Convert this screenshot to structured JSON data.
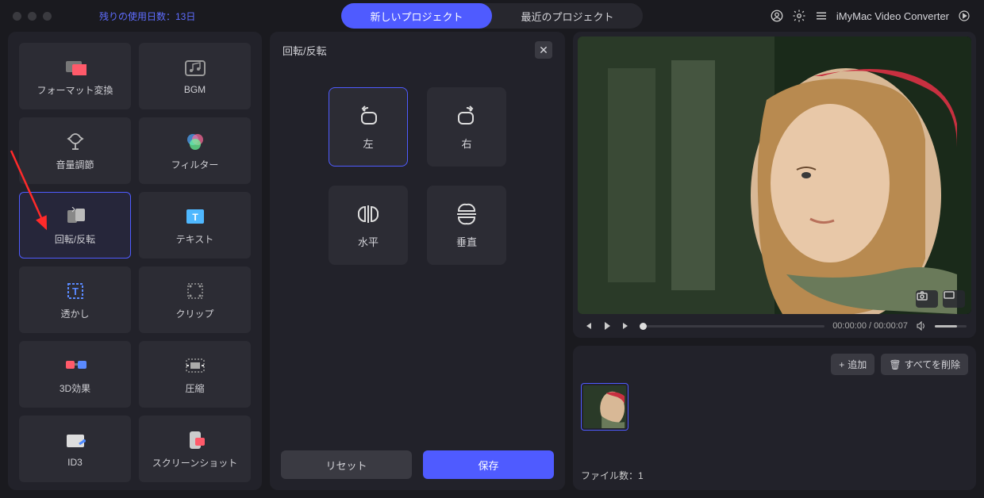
{
  "header": {
    "trial_text": "残りの使用日数：13日",
    "tabs": {
      "new_project": "新しいプロジェクト",
      "recent_projects": "最近のプロジェクト"
    },
    "app_title": "iMyMac Video Converter"
  },
  "sidebar": {
    "tools": {
      "format_convert": "フォーマット変換",
      "bgm": "BGM",
      "volume": "音量調節",
      "filter": "フィルター",
      "rotate": "回転/反転",
      "text": "テキスト",
      "watermark": "透かし",
      "clip": "クリップ",
      "effect3d": "3D効果",
      "compress": "圧縮",
      "id3": "ID3",
      "screenshot": "スクリーンショット"
    }
  },
  "panel": {
    "title": "回転/反転",
    "options": {
      "left": "左",
      "right": "右",
      "horizontal": "水平",
      "vertical": "垂直"
    },
    "reset": "リセット",
    "save": "保存"
  },
  "preview": {
    "time_current": "00:00:00",
    "time_total": "00:00:07",
    "time_display": "00:00:00 / 00:00:07"
  },
  "files": {
    "add_label": "追加",
    "delete_all_label": "すべてを削除",
    "count_label": "ファイル数：1"
  }
}
